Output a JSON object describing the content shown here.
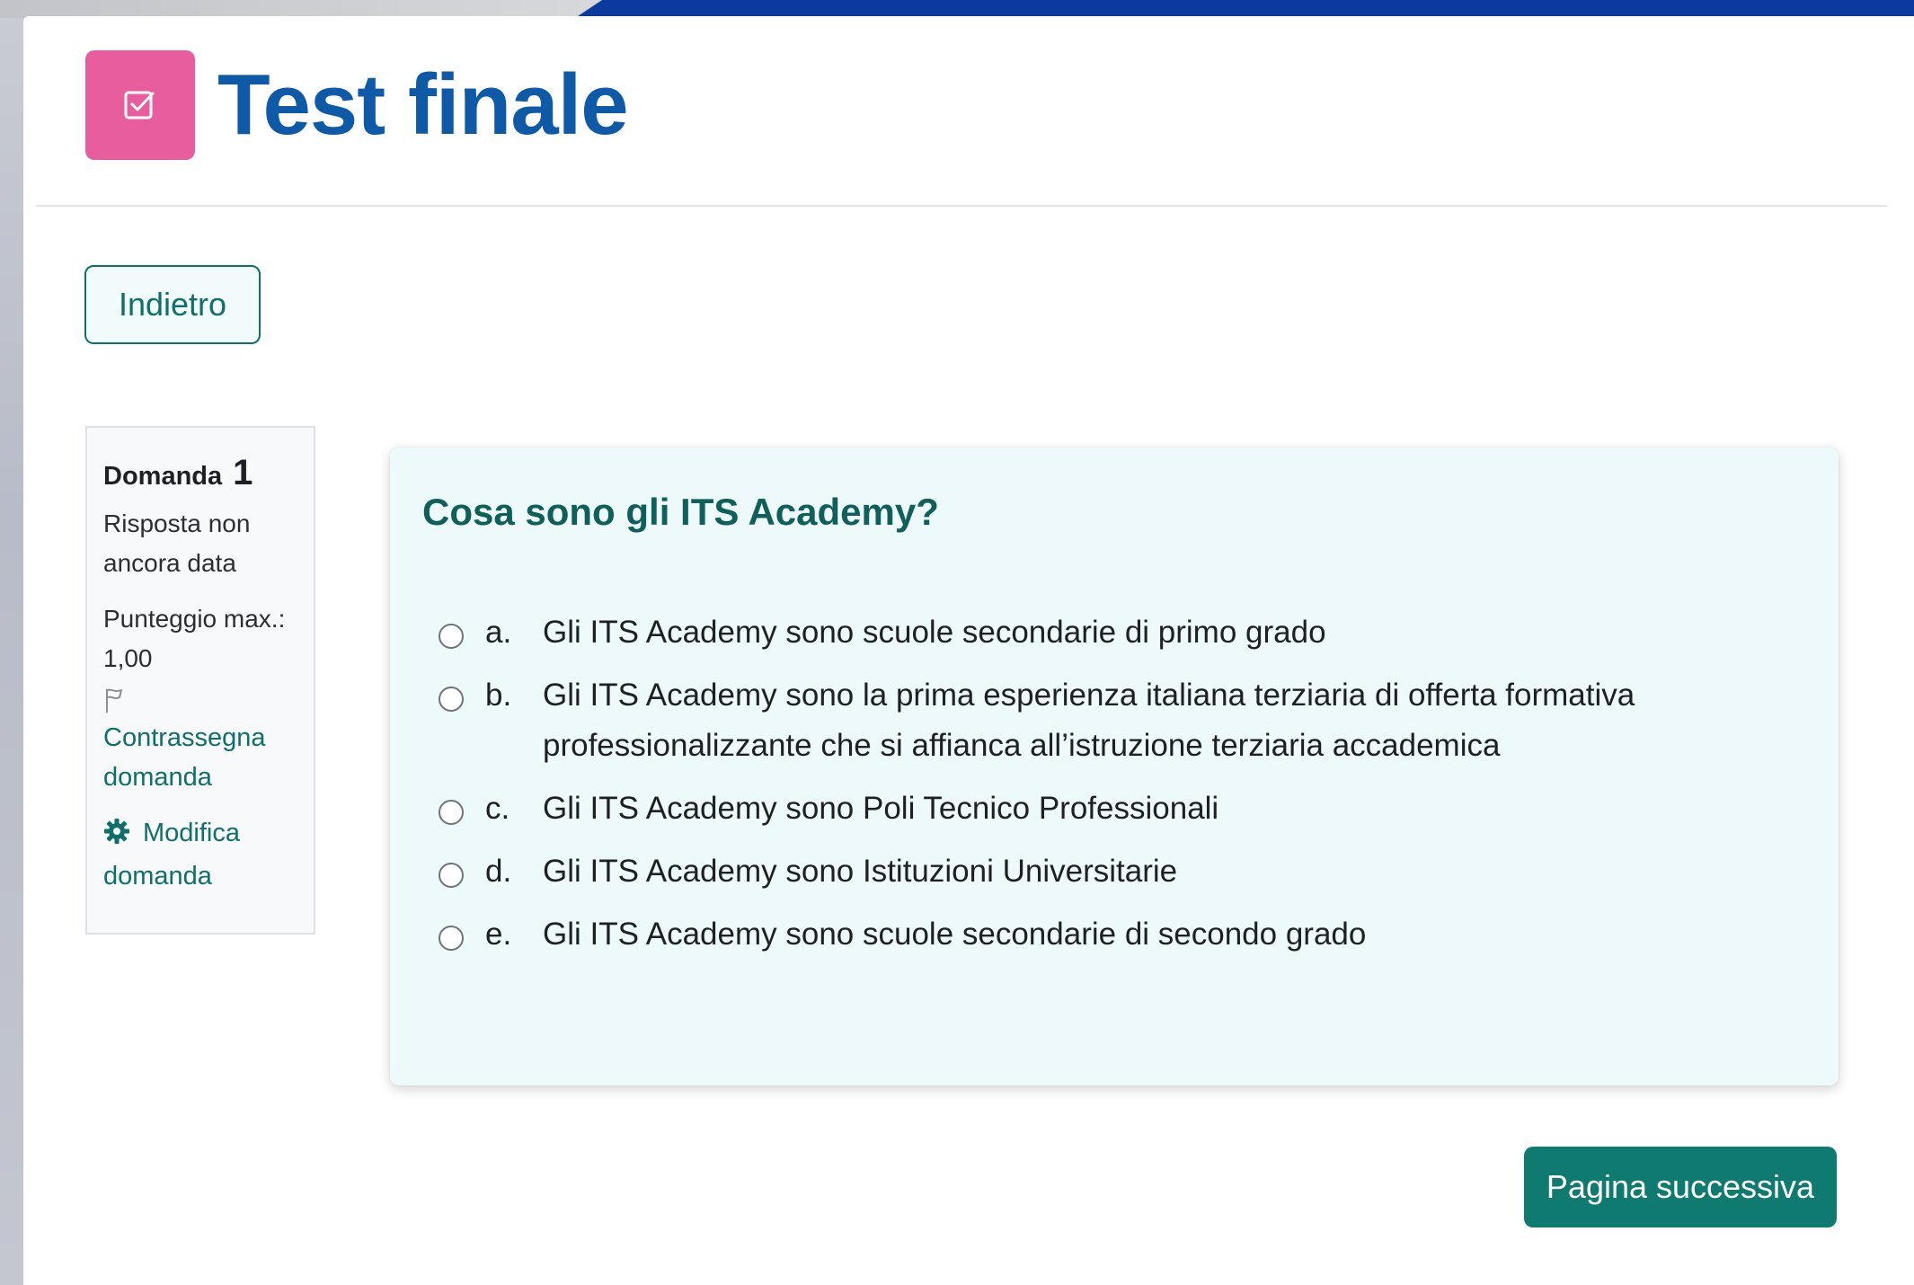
{
  "header": {
    "title": "Test finale"
  },
  "navigation": {
    "back_label": "Indietro",
    "next_label": "Pagina successiva"
  },
  "question_info": {
    "question_label": "Domanda",
    "question_number": "1",
    "status": "Risposta non ancora data",
    "max_score_label": "Punteggio max.:",
    "max_score_value": "1,00",
    "flag_link": "Contrassegna domanda",
    "edit_link": "Modifica domanda"
  },
  "question": {
    "text": "Cosa sono gli ITS Academy?",
    "answers": [
      {
        "letter": "a.",
        "text": "Gli ITS Academy sono scuole secondarie di primo grado"
      },
      {
        "letter": "b.",
        "text": "Gli ITS Academy sono la prima esperienza italiana terziaria di offerta formativa professionalizzante che si affianca all’istruzione terziaria accademica"
      },
      {
        "letter": "c.",
        "text": "Gli ITS Academy sono Poli Tecnico Professionali"
      },
      {
        "letter": "d.",
        "text": "Gli ITS Academy sono Istituzioni Universitarie"
      },
      {
        "letter": "e.",
        "text": "Gli ITS Academy sono scuole secondarie di secondo grado"
      }
    ],
    "selected": null
  },
  "colors": {
    "title": "#0f5aa8",
    "icon_bg": "#e85d9e",
    "accent": "#0f6f6a",
    "next_button": "#0f7a6f",
    "card_bg": "#eef9fb"
  },
  "icons": {
    "header_icon": "quiz-checkbox-icon",
    "flag_icon": "flag-icon",
    "edit_icon": "gear-icon"
  }
}
